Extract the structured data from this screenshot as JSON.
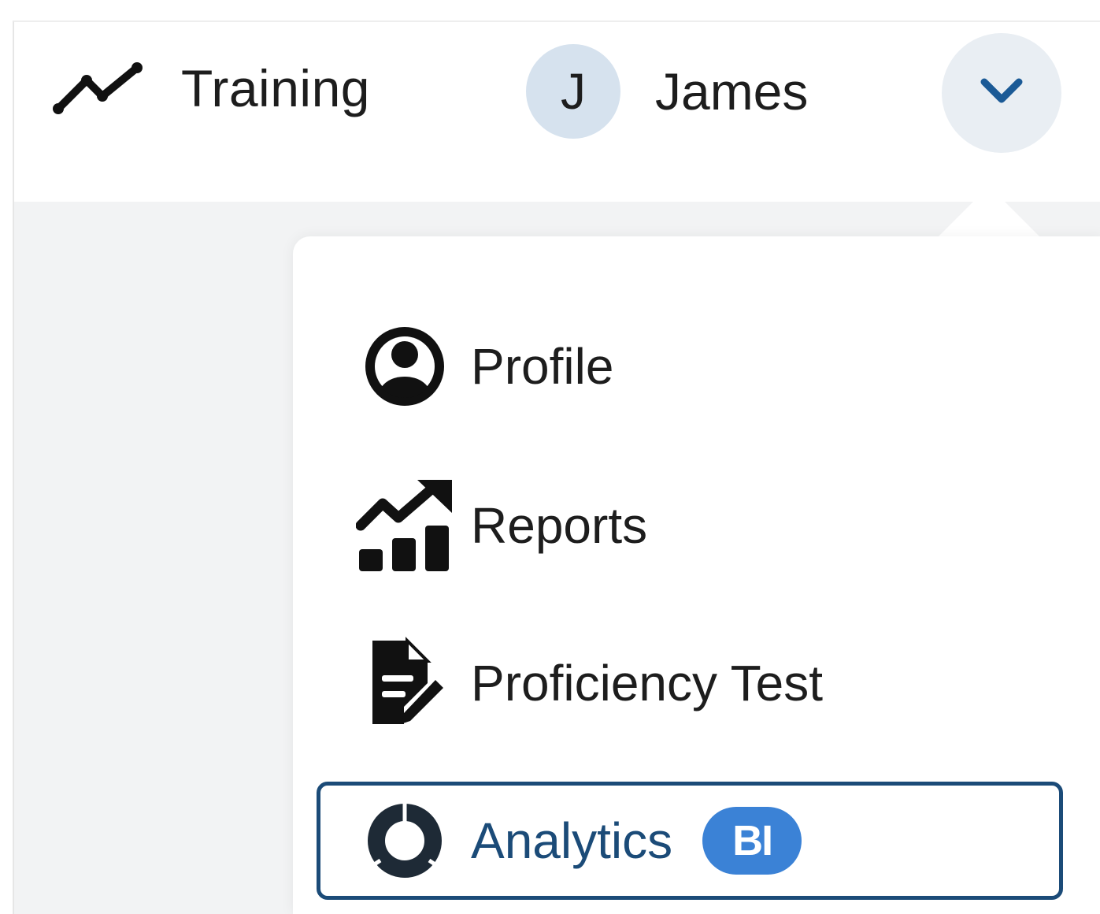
{
  "header": {
    "app_title": "Training",
    "user": {
      "initial": "J",
      "name": "James"
    },
    "menu_toggle_icon": "chevron-down-icon"
  },
  "dropdown": {
    "items": [
      {
        "label": "Profile",
        "icon": "user-circle-icon"
      },
      {
        "label": "Reports",
        "icon": "chart-growth-icon"
      },
      {
        "label": "Proficiency Test",
        "icon": "file-edit-icon"
      },
      {
        "label": "Analytics",
        "icon": "donut-chart-icon",
        "badge": "BI",
        "active": true
      }
    ]
  },
  "colors": {
    "accent": "#1b4b78",
    "badge": "#3b82d6",
    "avatar_bg": "#d6e2ee",
    "content_bg": "#f2f3f4"
  }
}
